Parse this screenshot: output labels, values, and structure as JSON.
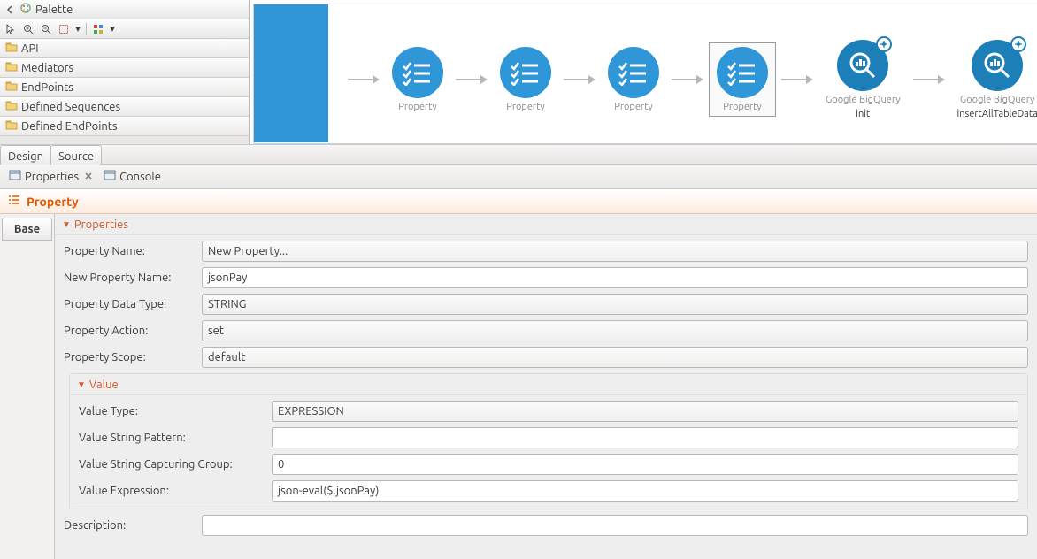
{
  "palette": {
    "title": "Palette",
    "drawers": [
      "API",
      "Mediators",
      "EndPoints",
      "Defined Sequences",
      "Defined EndPoints"
    ]
  },
  "flow": {
    "nodes": [
      {
        "type": "property",
        "label": "Property"
      },
      {
        "type": "property",
        "label": "Property"
      },
      {
        "type": "property",
        "label": "Property"
      },
      {
        "type": "property",
        "label": "Property",
        "selected": true
      },
      {
        "type": "bigquery",
        "label1": "Google BigQuery",
        "label2": "init"
      },
      {
        "type": "bigquery",
        "label1": "Google BigQuery",
        "label2": "insertAllTableData"
      }
    ]
  },
  "designSource": {
    "design": "Design",
    "source": "Source"
  },
  "views": {
    "properties": "Properties",
    "console": "Console"
  },
  "propHeader": "Property",
  "sideTab": "Base",
  "sections": {
    "properties": {
      "title": "Properties",
      "fields": {
        "propertyName": {
          "label": "Property Name:",
          "value": "New Property..."
        },
        "newPropertyName": {
          "label": "New Property Name:",
          "value": "jsonPay"
        },
        "dataType": {
          "label": "Property Data Type:",
          "value": "STRING"
        },
        "action": {
          "label": "Property Action:",
          "value": "set"
        },
        "scope": {
          "label": "Property Scope:",
          "value": "default"
        }
      }
    },
    "value": {
      "title": "Value",
      "fields": {
        "valueType": {
          "label": "Value Type:",
          "value": "EXPRESSION"
        },
        "pattern": {
          "label": "Value String Pattern:",
          "value": ""
        },
        "capGroup": {
          "label": "Value String Capturing Group:",
          "value": "0"
        },
        "expr": {
          "label": "Value Expression:",
          "value": "json-eval($.jsonPay)"
        }
      }
    },
    "description": {
      "label": "Description:",
      "value": ""
    }
  }
}
